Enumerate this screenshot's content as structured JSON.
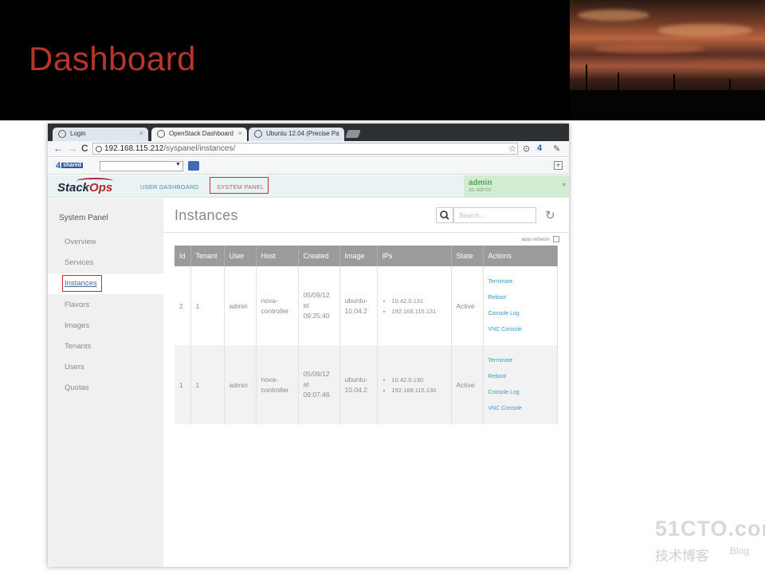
{
  "slide": {
    "title": "Dashboard"
  },
  "browser": {
    "tabs": [
      {
        "label": "Login"
      },
      {
        "label": "OpenStack Dashboard"
      },
      {
        "label": "Ubuntu 12.04 (Precise Pa"
      }
    ],
    "url_host": "192.168.115.212",
    "url_path": "/syspanel/instances/"
  },
  "toolbar": {
    "logo": "4",
    "logo_badge": "shared"
  },
  "header": {
    "brand_main": "Stack",
    "brand_accent": "Ops",
    "nav": [
      "USER DASHBOARD",
      "SYSTEM PANEL"
    ],
    "user_name": "admin",
    "user_sub": "as admin"
  },
  "sidebar": {
    "title": "System Panel",
    "items": [
      "Overview",
      "Services",
      "Instances",
      "Flavors",
      "Images",
      "Tenants",
      "Users",
      "Quotas"
    ],
    "active": "Instances"
  },
  "main": {
    "title": "Instances",
    "search_placeholder": "Search...",
    "auto_refresh_label": "auto refresh",
    "columns": [
      "Id",
      "Tenant",
      "User",
      "Host",
      "Created",
      "Image",
      "IPs",
      "State",
      "Actions"
    ],
    "rows": [
      {
        "id": "2",
        "tenant": "1",
        "user": "admin",
        "host": "nova-\ncontroller",
        "created": "05/09/12\nat\n09:25:40",
        "image": "ubuntu-\n10.04.2",
        "ips": [
          "10.42.0.131",
          "192.168.115.131"
        ],
        "state": "Active",
        "actions": [
          "Terminate",
          "Reboot",
          "Console Log",
          "VNC Console"
        ]
      },
      {
        "id": "1",
        "tenant": "1",
        "user": "admin",
        "host": "nova-\ncontroller",
        "created": "05/09/12\nat\n09:07:46",
        "image": "ubuntu-\n10.04.2",
        "ips": [
          "10.42.0.130",
          "192.168.115.130"
        ],
        "state": "Active",
        "actions": [
          "Terminate",
          "Reboot",
          "Console Log",
          "VNC Console"
        ]
      }
    ]
  },
  "watermark": {
    "line1": "51CTO.com",
    "line2": "技术博客",
    "line3": "Blog"
  }
}
